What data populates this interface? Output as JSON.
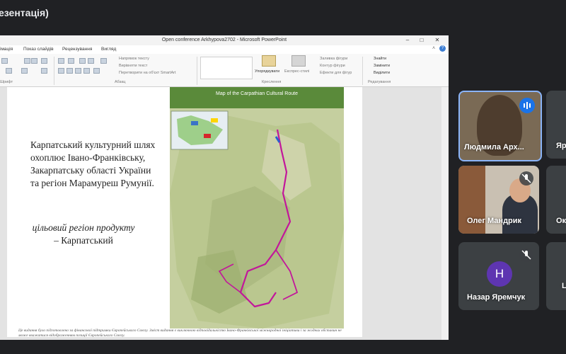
{
  "window_title": "езентація)",
  "ppt": {
    "title": "Open conference Arkhypova2702  -  Microsoft PowerPoint",
    "tabs": [
      "імація",
      "Показ слайдів",
      "Рецензування",
      "Вигляд"
    ],
    "ribbon": {
      "text_direction": "Напрямок тексту",
      "align_text": "Вирівняти текст",
      "convert_smartart": "Перетворити на об'єкт SmartArt",
      "arrange": "Упорядкувати",
      "quick_styles": "Експрес-стилі",
      "shape_fill": "Заливка фігури",
      "shape_outline": "Контур фігури",
      "shape_effects": "Ефекти для фігур",
      "find": "Знайти",
      "replace": "Замінити",
      "select": "Виділити",
      "groups": {
        "font": "Шрифт",
        "paragraph": "Абзац",
        "drawing": "Креслення",
        "editing": "Редагування"
      }
    },
    "slide": {
      "text1": "Карпатський культурний шлях охоплює Івано-Франківську, Закарпатську області України та регіон Марамуреш Румунії.",
      "text2_italic": "цільовий регіон продукту",
      "text2_plain": "– Карпатський",
      "map_title": "Map of the Carpathian Cultural Route",
      "footnote": "Це видання було підготовлено за фінансової підтримки Європейського Союзу. Зміст видання є виключною відповідальністю Івано-Франківської міжнародної ініціативи і за жодних обставин не може вважатися відображенням позиції Європейського Союзу."
    }
  },
  "participants": [
    {
      "name": "Людмила Арх...",
      "speaking": true
    },
    {
      "name": "Яр"
    },
    {
      "name": "Олег Мандрик",
      "muted": true
    },
    {
      "name": "Ок"
    },
    {
      "name": "Назар Яремчук",
      "initial": "Н",
      "muted": true
    },
    {
      "name": "L"
    }
  ]
}
